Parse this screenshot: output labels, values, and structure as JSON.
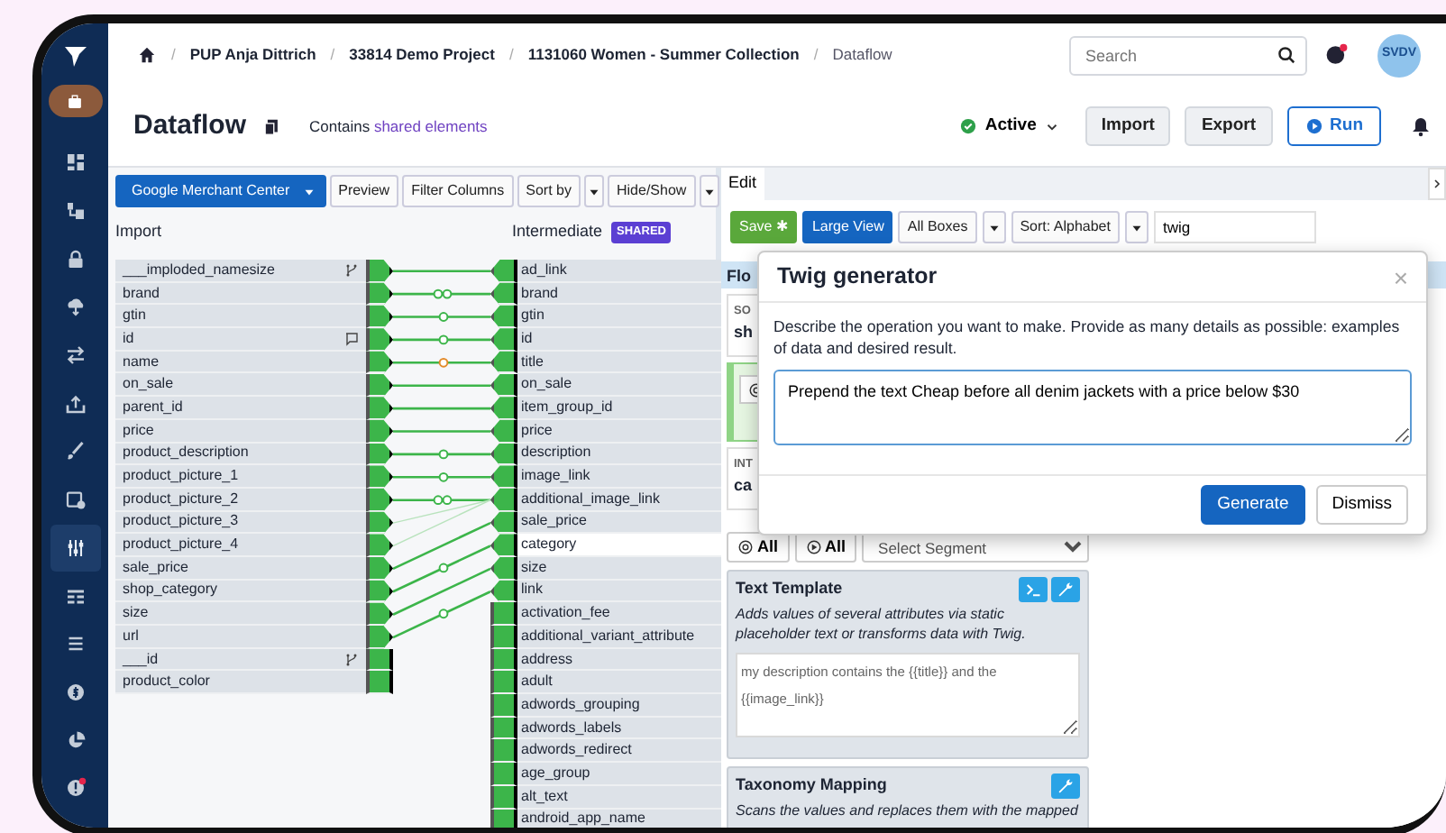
{
  "sidebar": {
    "items": [
      {
        "kind": "briefcase",
        "selected": false
      },
      {
        "kind": "dashboard",
        "selected": false
      },
      {
        "kind": "hierarchy",
        "selected": false
      },
      {
        "kind": "lock",
        "selected": false
      },
      {
        "kind": "cloud",
        "selected": false
      },
      {
        "kind": "swap",
        "selected": false
      },
      {
        "kind": "upload",
        "selected": false
      },
      {
        "kind": "brush",
        "selected": false
      },
      {
        "kind": "calendar",
        "selected": false
      },
      {
        "kind": "sliders",
        "selected": true
      },
      {
        "kind": "table",
        "selected": false
      },
      {
        "kind": "list",
        "selected": false
      },
      {
        "kind": "dollar",
        "selected": false
      },
      {
        "kind": "pie",
        "selected": false
      },
      {
        "kind": "alert",
        "selected": false
      }
    ]
  },
  "breadcrumb": {
    "items": [
      {
        "separator": "/",
        "label": "PUP Anja Dittrich"
      },
      {
        "separator": "/",
        "label": "33814 Demo Project"
      },
      {
        "separator": "/",
        "label": "1131060 Women - Summer Collection"
      },
      {
        "separator": "/",
        "label": "Dataflow"
      }
    ]
  },
  "search": {
    "placeholder": "Search"
  },
  "avatar": {
    "initials": "SVDV"
  },
  "page": {
    "title": "Dataflow",
    "note": "Contains",
    "note_link": "shared elements",
    "status": "Active",
    "active": true,
    "buttons": [
      "Import",
      "Export"
    ],
    "run": "Run"
  },
  "mapping": {
    "toolbar": [
      {
        "label": "Google Merchant Center",
        "kind": "primary-dropdown"
      },
      {
        "label": "Preview",
        "kind": "plain"
      },
      {
        "label": "Filter Columns",
        "kind": "plain"
      },
      {
        "label": "Sort by",
        "kind": "split"
      },
      {
        "label": "Hide/Show",
        "kind": "split"
      }
    ],
    "import_title": "Import",
    "intermediate_title": "Intermediate",
    "shared_badge": "SHARED",
    "import_fields": [
      {
        "name": "___imploded_namesize",
        "mapped": true,
        "kind": "branch"
      },
      {
        "name": "brand",
        "mapped": true
      },
      {
        "name": "gtin",
        "mapped": true
      },
      {
        "name": "id",
        "mapped": true,
        "kind": "comment"
      },
      {
        "name": "name",
        "mapped": true
      },
      {
        "name": "on_sale",
        "mapped": true
      },
      {
        "name": "parent_id",
        "mapped": true
      },
      {
        "name": "price",
        "mapped": true
      },
      {
        "name": "product_description",
        "mapped": true
      },
      {
        "name": "product_picture_1",
        "mapped": true
      },
      {
        "name": "product_picture_2",
        "mapped": true
      },
      {
        "name": "product_picture_3",
        "mapped": true
      },
      {
        "name": "product_picture_4",
        "mapped": true
      },
      {
        "name": "sale_price",
        "mapped": true
      },
      {
        "name": "shop_category",
        "mapped": true
      },
      {
        "name": "size",
        "mapped": true
      },
      {
        "name": "url",
        "mapped": true
      },
      {
        "name": "___id",
        "mapped": false,
        "kind": "branch"
      },
      {
        "name": "product_color",
        "mapped": false
      }
    ],
    "intermediate_fields": [
      {
        "name": "ad_link",
        "mapped": true,
        "selected": false
      },
      {
        "name": "brand",
        "mapped": true,
        "selected": false
      },
      {
        "name": "gtin",
        "mapped": true,
        "selected": false
      },
      {
        "name": "id",
        "mapped": true,
        "selected": false
      },
      {
        "name": "title",
        "mapped": true,
        "selected": false
      },
      {
        "name": "on_sale",
        "mapped": true,
        "selected": false
      },
      {
        "name": "item_group_id",
        "mapped": true,
        "selected": false
      },
      {
        "name": "price",
        "mapped": true,
        "selected": false
      },
      {
        "name": "description",
        "mapped": true,
        "selected": false
      },
      {
        "name": "image_link",
        "mapped": true,
        "selected": false
      },
      {
        "name": "additional_image_link",
        "mapped": true,
        "selected": false
      },
      {
        "name": "sale_price",
        "mapped": true,
        "selected": false
      },
      {
        "name": "category",
        "mapped": true,
        "selected": true
      },
      {
        "name": "size",
        "mapped": true,
        "selected": false
      },
      {
        "name": "link",
        "mapped": true,
        "selected": false
      },
      {
        "name": "activation_fee",
        "mapped": false,
        "selected": false
      },
      {
        "name": "additional_variant_attribute",
        "mapped": false,
        "selected": false
      },
      {
        "name": "address",
        "mapped": false,
        "selected": false
      },
      {
        "name": "adult",
        "mapped": false,
        "selected": false
      },
      {
        "name": "adwords_grouping",
        "mapped": false,
        "selected": false
      },
      {
        "name": "adwords_labels",
        "mapped": false,
        "selected": false
      },
      {
        "name": "adwords_redirect",
        "mapped": false,
        "selected": false
      },
      {
        "name": "age_group",
        "mapped": false,
        "selected": false
      },
      {
        "name": "alt_text",
        "mapped": false,
        "selected": false
      },
      {
        "name": "android_app_name",
        "mapped": false,
        "selected": false
      }
    ]
  },
  "editor": {
    "tab": "Edit",
    "toolbar": [
      {
        "label": "Save ✱",
        "kind": "success"
      },
      {
        "label": "Large View",
        "kind": "primary"
      },
      {
        "label": "All Boxes",
        "kind": "split"
      },
      {
        "label": "Sort: Alphabet",
        "kind": "split"
      }
    ],
    "filter_value": "twig",
    "band": "Flo",
    "cards": [
      {
        "kind": "source",
        "caption": "SO",
        "value": "sh"
      },
      {
        "kind": "active"
      },
      {
        "kind": "intermediate",
        "caption": "INT",
        "value": "ca"
      }
    ],
    "all_buttons": [
      {
        "label": "All",
        "kind": "target"
      },
      {
        "label": "All",
        "kind": "cycle"
      }
    ],
    "segment_placeholder": "Select Segment",
    "modules": [
      {
        "kind": "template",
        "title": "Text Template",
        "description": "Adds values of several attributes via static placeholder text or transforms data with Twig.",
        "template": "my description contains the {{title}} and the {{image_link}}"
      },
      {
        "kind": "taxonomy",
        "title": "Taxonomy Mapping",
        "description": "Scans the values and replaces them with the mapped"
      }
    ]
  },
  "modal": {
    "title": "Twig generator",
    "close": "×",
    "description": "Describe the operation you want to make. Provide as many details as possible: examples of data and desired result.",
    "value": "Prepend the text Cheap before all denim jackets with a price below $30",
    "buttons": [
      {
        "label": "Generate",
        "kind": "primary"
      },
      {
        "label": "Dismiss",
        "kind": "secondary"
      }
    ]
  }
}
